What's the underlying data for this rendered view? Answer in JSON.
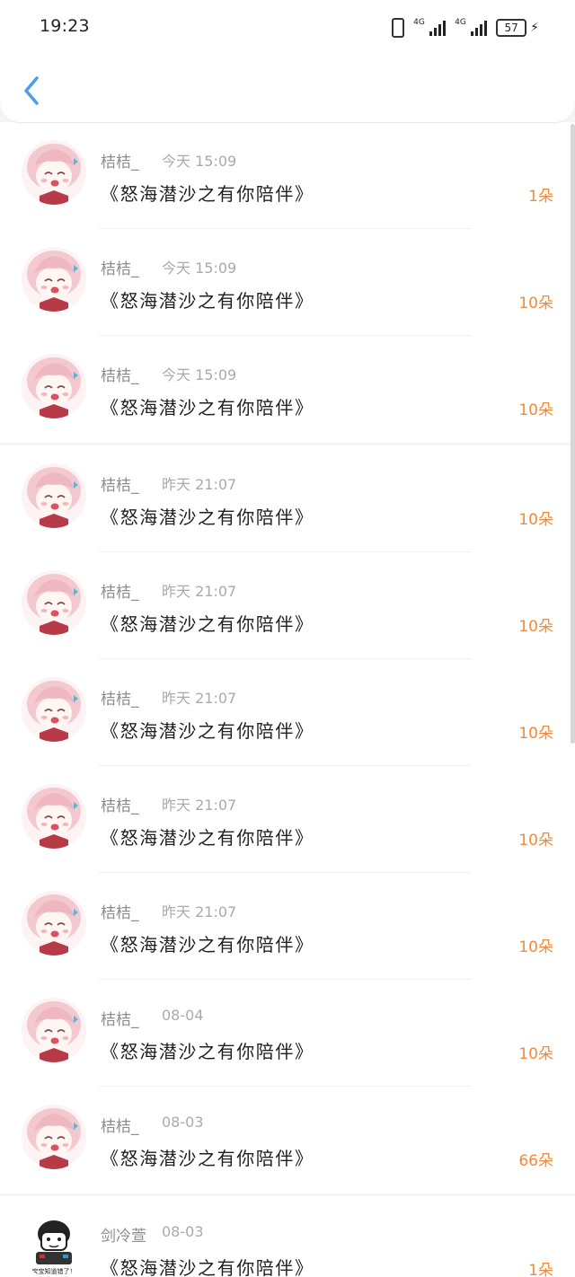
{
  "status_bar": {
    "time": "19:23",
    "net1_label": "4G",
    "net2_label": "4G",
    "battery": "57",
    "icons": [
      "vibrate-icon",
      "signal-icon",
      "signal-icon",
      "battery-icon",
      "charging-icon"
    ]
  },
  "nav": {
    "back_icon": "chevron-left-icon"
  },
  "colors": {
    "accent_blue": "#4a9fe6",
    "count_orange": "#f08a3c"
  },
  "groups": [
    {
      "items": [
        {
          "name": "桔桔_",
          "time": "今天 15:09",
          "title": "《怒海潜沙之有你陪伴》",
          "count": "1朵",
          "avatar": "anime-girl-avatar"
        },
        {
          "name": "桔桔_",
          "time": "今天 15:09",
          "title": "《怒海潜沙之有你陪伴》",
          "count": "10朵",
          "avatar": "anime-girl-avatar"
        },
        {
          "name": "桔桔_",
          "time": "今天 15:09",
          "title": "《怒海潜沙之有你陪伴》",
          "count": "10朵",
          "avatar": "anime-girl-avatar"
        }
      ]
    },
    {
      "items": [
        {
          "name": "桔桔_",
          "time": "昨天 21:07",
          "title": "《怒海潜沙之有你陪伴》",
          "count": "10朵",
          "avatar": "anime-girl-avatar"
        },
        {
          "name": "桔桔_",
          "time": "昨天 21:07",
          "title": "《怒海潜沙之有你陪伴》",
          "count": "10朵",
          "avatar": "anime-girl-avatar"
        },
        {
          "name": "桔桔_",
          "time": "昨天 21:07",
          "title": "《怒海潜沙之有你陪伴》",
          "count": "10朵",
          "avatar": "anime-girl-avatar"
        },
        {
          "name": "桔桔_",
          "time": "昨天 21:07",
          "title": "《怒海潜沙之有你陪伴》",
          "count": "10朵",
          "avatar": "anime-girl-avatar"
        },
        {
          "name": "桔桔_",
          "time": "昨天 21:07",
          "title": "《怒海潜沙之有你陪伴》",
          "count": "10朵",
          "avatar": "anime-girl-avatar"
        },
        {
          "name": "桔桔_",
          "time": "08-04",
          "title": "《怒海潜沙之有你陪伴》",
          "count": "10朵",
          "avatar": "anime-girl-avatar"
        },
        {
          "name": "桔桔_",
          "time": "08-03",
          "title": "《怒海潜沙之有你陪伴》",
          "count": "66朵",
          "avatar": "anime-girl-avatar"
        }
      ]
    },
    {
      "items": [
        {
          "name": "剑冷萱",
          "time": "08-03",
          "title": "《怒海潜沙之有你陪伴》",
          "count": "1朵",
          "avatar": "meme-character-avatar",
          "avatar_caption": "宝宝知道错了！"
        }
      ]
    }
  ]
}
